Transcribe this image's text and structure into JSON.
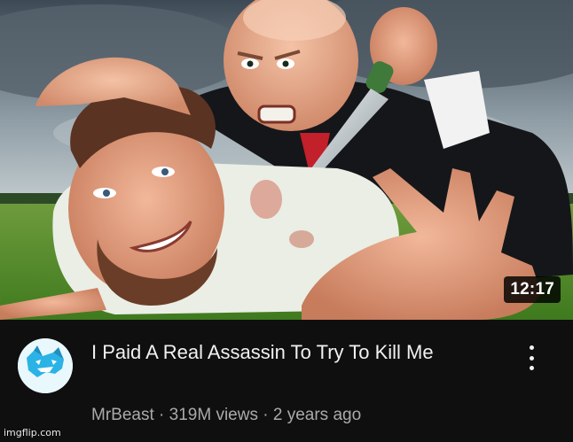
{
  "video": {
    "duration": "12:17",
    "title": "I Paid A Real Assassin To Try To Kill Me",
    "channel": "MrBeast",
    "separator": "·",
    "views": "319M views",
    "age": "2 years ago"
  },
  "icons": {
    "more": "vertical-ellipsis-icon",
    "avatar": "mrbeast-panther-logo"
  },
  "colors": {
    "background": "#0f0f0f",
    "title_text": "#f1f1f1",
    "secondary_text": "#aaaaaa",
    "avatar_blue": "#2bb3e6"
  },
  "watermark": "imgflip.com"
}
